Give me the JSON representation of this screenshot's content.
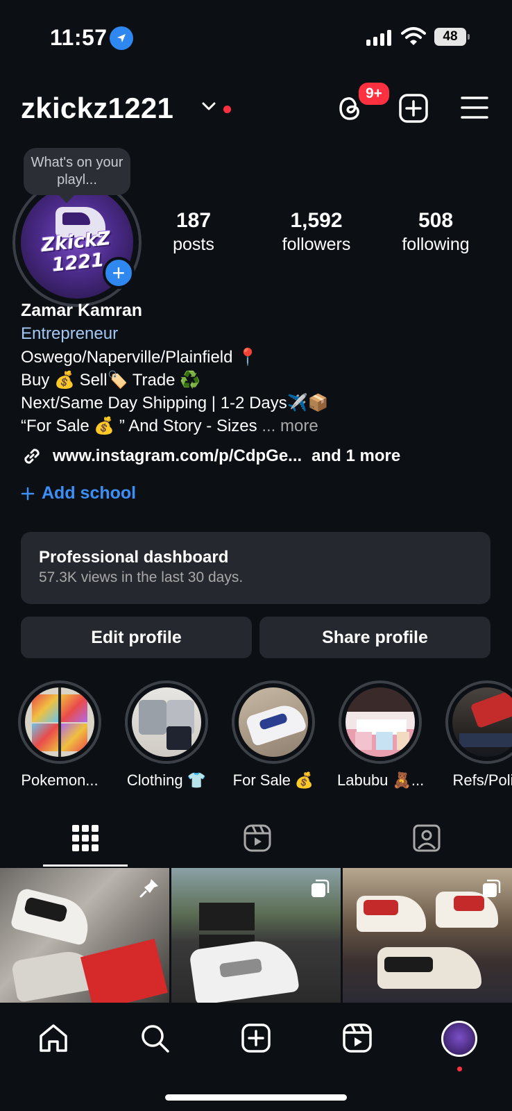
{
  "status_bar": {
    "time": "11:57",
    "battery": "48"
  },
  "header": {
    "username": "zkickz1221",
    "notification_badge": "9+"
  },
  "profile": {
    "bubble_note": "What's on your playl...",
    "avatar_text": "ZkickZ 1221",
    "stats": [
      {
        "value": "187",
        "label": "posts"
      },
      {
        "value": "1,592",
        "label": "followers"
      },
      {
        "value": "508",
        "label": "following"
      }
    ],
    "name": "Zamar Kamran",
    "category": "Entrepreneur",
    "bio_lines": [
      "Oswego/Naperville/Plainfield 📍",
      "Buy 💰 Sell🏷️ Trade ♻️",
      "Next/Same Day Shipping | 1-2 Days✈️📦",
      "“For Sale 💰 ” And Story - Sizes"
    ],
    "more_label": "... more",
    "link_text": "www.instagram.com/p/CdpGe...",
    "link_more": "and 1 more",
    "add_school": "Add school"
  },
  "dashboard": {
    "title": "Professional dashboard",
    "subtitle": "57.3K views in the last 30 days."
  },
  "buttons": {
    "edit": "Edit profile",
    "share": "Share profile"
  },
  "highlights": [
    {
      "label": "Pokemon..."
    },
    {
      "label": "Clothing 👕"
    },
    {
      "label": "For Sale 💰"
    },
    {
      "label": "Labubu 🧸..."
    },
    {
      "label": "Refs/Polic"
    }
  ],
  "colors": {
    "background": "#0c1015",
    "accent": "#2f87f0",
    "badge": "#ff3040",
    "category": "#a3c8f5"
  },
  "icons": [
    "threads-icon",
    "create-post-icon",
    "menu-icon",
    "grid-icon",
    "reels-icon",
    "tagged-icon",
    "home-icon",
    "search-icon",
    "create-icon",
    "reels-nav-icon"
  ]
}
